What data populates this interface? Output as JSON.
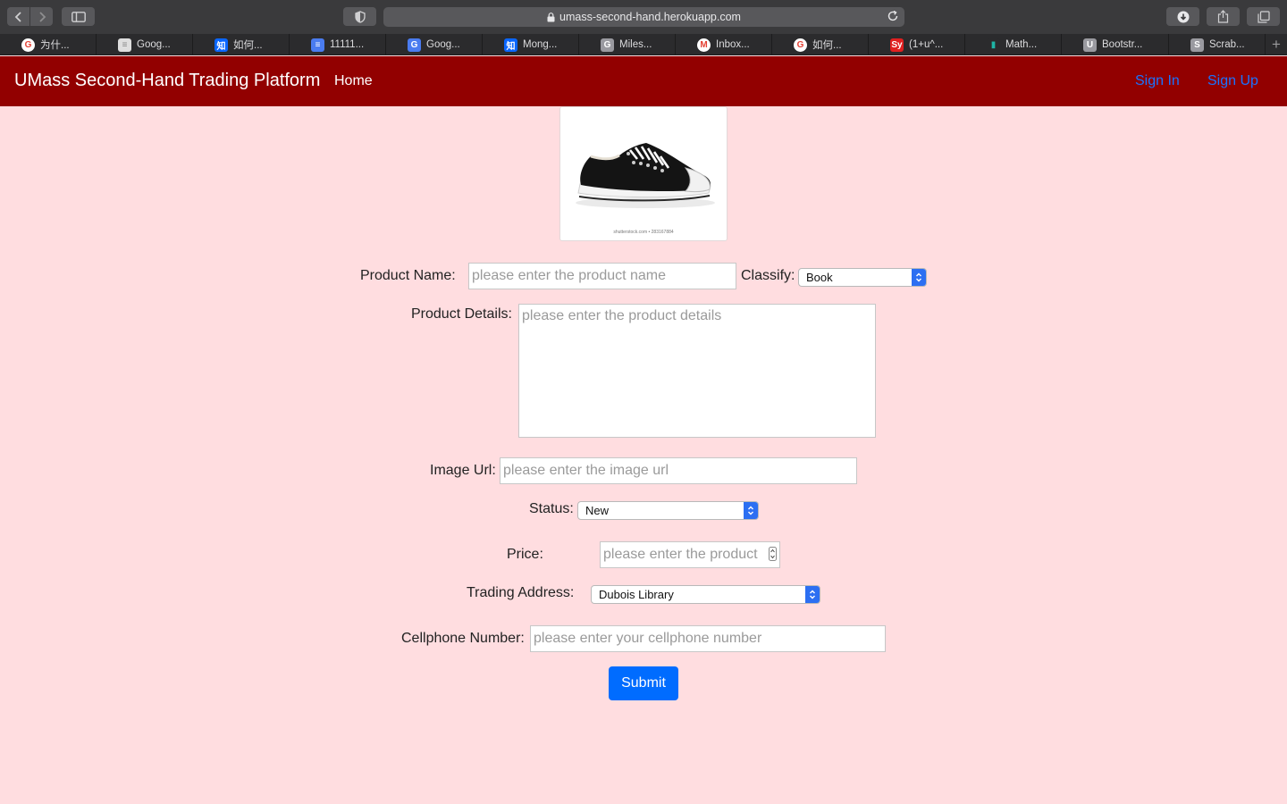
{
  "browser": {
    "url": "umass-second-hand.herokuapp.com",
    "tabs": [
      {
        "label": "为什...",
        "icon": "google-icon",
        "color": "#ffffff"
      },
      {
        "label": "Goog...",
        "icon": "google-docs-icon",
        "color": "#dedede"
      },
      {
        "label": "如何...",
        "icon": "zhihu-icon",
        "color": "#0a66ff"
      },
      {
        "label": "11111...",
        "icon": "google-docs-icon",
        "color": "#4a7cf0"
      },
      {
        "label": "Goog...",
        "icon": "google-translate-icon",
        "color": "#4a7cf0"
      },
      {
        "label": "Mong...",
        "icon": "zhihu-icon",
        "color": "#0a66ff"
      },
      {
        "label": "Miles...",
        "icon": "g-letter-icon",
        "color": "#9a9aa0"
      },
      {
        "label": "Inbox...",
        "icon": "gmail-icon",
        "color": "#ffffff"
      },
      {
        "label": "如何...",
        "icon": "google-icon",
        "color": "#ffffff"
      },
      {
        "label": "(1+u^...",
        "icon": "symbolab-icon",
        "color": "#e02020"
      },
      {
        "label": "Math...",
        "icon": "chart-icon",
        "color": "#2b2b2d"
      },
      {
        "label": "Bootstr...",
        "icon": "u-letter-icon",
        "color": "#9a9aa0"
      },
      {
        "label": "Scrab...",
        "icon": "s-letter-icon",
        "color": "#9a9aa0"
      }
    ]
  },
  "navbar": {
    "brand": "UMass Second-Hand Trading Platform",
    "home": "Home",
    "sign_in": "Sign In",
    "sign_up": "Sign Up",
    "bg_color": "#920000",
    "link_color": "#1a73ff"
  },
  "product_image": {
    "icon": "sneaker-image",
    "caption": "shutterstock.com • 283167884"
  },
  "form": {
    "product_name": {
      "label": "Product Name:",
      "placeholder": "please enter the product name",
      "value": ""
    },
    "classify": {
      "label": "Classify:",
      "value": "Book"
    },
    "product_details": {
      "label": "Product Details:",
      "placeholder": "please enter the product details",
      "value": ""
    },
    "image_url": {
      "label": "Image Url:",
      "placeholder": "please enter the image url",
      "value": ""
    },
    "status": {
      "label": "Status:",
      "value": "New"
    },
    "price": {
      "label": "Price:",
      "placeholder": "please enter the product",
      "value": ""
    },
    "trading_address": {
      "label": "Trading Address:",
      "value": "Dubois Library"
    },
    "cellphone": {
      "label": "Cellphone Number:",
      "placeholder": "please enter your cellphone number",
      "value": ""
    },
    "submit": "Submit"
  },
  "colors": {
    "page_bg": "#ffdde0",
    "submit_bg": "#006cff"
  }
}
